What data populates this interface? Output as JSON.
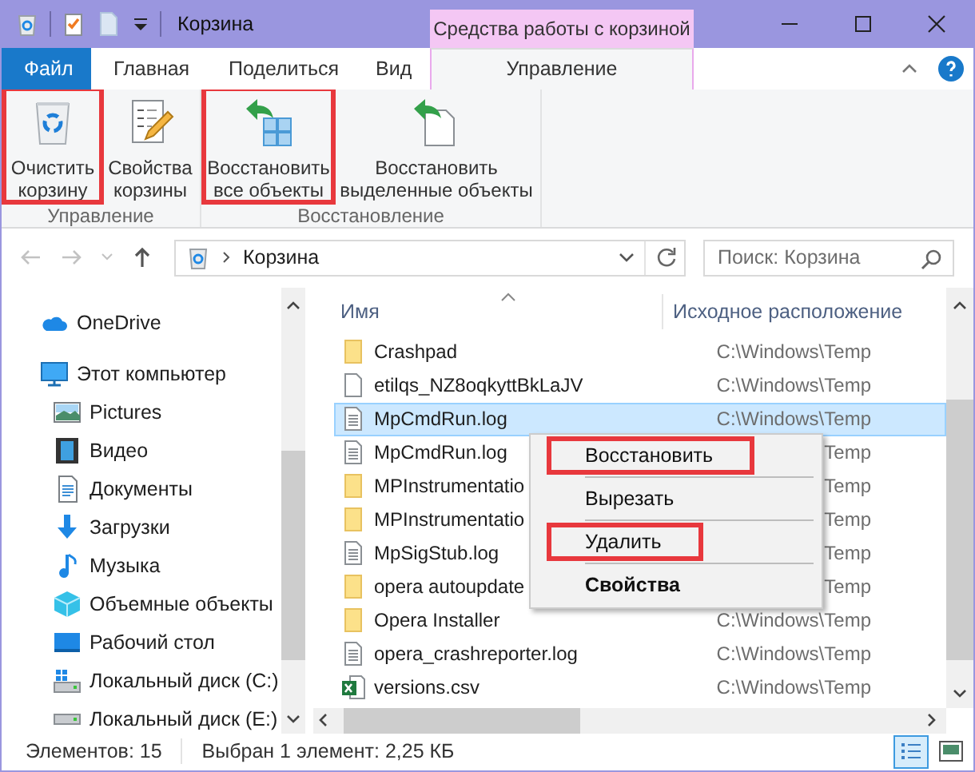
{
  "window": {
    "title": "Корзина",
    "context_label": "Средства работы с корзиной"
  },
  "ribbon": {
    "tabs": [
      {
        "label": "Файл",
        "kind": "file",
        "selected": false
      },
      {
        "label": "Главная",
        "kind": "tab",
        "selected": false
      },
      {
        "label": "Поделиться",
        "kind": "tab",
        "selected": false
      },
      {
        "label": "Вид",
        "kind": "tab",
        "selected": false
      },
      {
        "label": "Управление",
        "kind": "context",
        "selected": true
      }
    ],
    "groups": [
      {
        "label": "Управление",
        "buttons": [
          {
            "label": "Очистить\nкорзину",
            "kind": "empty-bin",
            "highlighted": true
          },
          {
            "label": "Свойства\nкорзины",
            "kind": "properties",
            "highlighted": false
          }
        ]
      },
      {
        "label": "Восстановление",
        "buttons": [
          {
            "label": "Восстановить\nвсе объекты",
            "kind": "restore-all",
            "highlighted": true
          },
          {
            "label": "Восстановить\nвыделенные объекты",
            "kind": "restore-selected",
            "highlighted": false
          }
        ]
      }
    ]
  },
  "address": {
    "path": "Корзина"
  },
  "search": {
    "placeholder": "Поиск: Корзина"
  },
  "navigation": {
    "items": [
      {
        "label": "OneDrive",
        "kind": "cloud"
      },
      {
        "label": "Этот компьютер",
        "kind": "computer",
        "children": [
          {
            "label": "Pictures",
            "kind": "pictures"
          },
          {
            "label": "Видео",
            "kind": "video"
          },
          {
            "label": "Документы",
            "kind": "documents"
          },
          {
            "label": "Загрузки",
            "kind": "downloads"
          },
          {
            "label": "Музыка",
            "kind": "music"
          },
          {
            "label": "Объемные объекты",
            "kind": "objects3d"
          },
          {
            "label": "Рабочий стол",
            "kind": "desktop"
          },
          {
            "label": "Локальный диск (C:)",
            "kind": "system-drive"
          },
          {
            "label": "Локальный диск (E:)",
            "kind": "drive"
          }
        ]
      }
    ]
  },
  "files": {
    "columns": [
      "Имя",
      "Исходное расположение"
    ],
    "rows": [
      {
        "name": "Crashpad",
        "kind": "folder",
        "location": "C:\\Windows\\Temp",
        "selected": false
      },
      {
        "name": "etilqs_NZ8oqkyttBkLaJV",
        "kind": "file",
        "location": "C:\\Windows\\Temp",
        "selected": false
      },
      {
        "name": "MpCmdRun.log",
        "kind": "log",
        "location": "C:\\Windows\\Temp",
        "selected": true
      },
      {
        "name": "MpCmdRun.log",
        "kind": "log",
        "location": "Temp",
        "selected": false
      },
      {
        "name": "MPInstrumentatio",
        "kind": "folder",
        "location": "Temp",
        "selected": false
      },
      {
        "name": "MPInstrumentatio",
        "kind": "folder",
        "location": "Temp",
        "selected": false
      },
      {
        "name": "MpSigStub.log",
        "kind": "log",
        "location": "Temp",
        "selected": false
      },
      {
        "name": "opera autoupdate",
        "kind": "folder",
        "location": "Temp",
        "selected": false
      },
      {
        "name": "Opera Installer",
        "kind": "folder",
        "location": "C:\\Windows\\Temp",
        "selected": false
      },
      {
        "name": "opera_crashreporter.log",
        "kind": "log",
        "location": "C:\\Windows\\Temp",
        "selected": false
      },
      {
        "name": "versions.csv",
        "kind": "spreadsheet",
        "location": "C:\\Windows\\Temp",
        "selected": false
      }
    ]
  },
  "context_menu": {
    "items": [
      {
        "label": "Восстановить",
        "highlighted": true,
        "default": false,
        "separator_after": true
      },
      {
        "label": "Вырезать",
        "highlighted": false,
        "default": false,
        "separator_after": true
      },
      {
        "label": "Удалить",
        "highlighted": true,
        "default": false,
        "separator_after": true
      },
      {
        "label": "Свойства",
        "highlighted": false,
        "default": true,
        "separator_after": false
      }
    ]
  },
  "status_bar": {
    "count": "Элементов: 15",
    "selection": "Выбран 1 элемент: 2,25 КБ",
    "views": [
      {
        "kind": "details",
        "selected": true
      },
      {
        "kind": "large-icons",
        "selected": false
      }
    ]
  }
}
